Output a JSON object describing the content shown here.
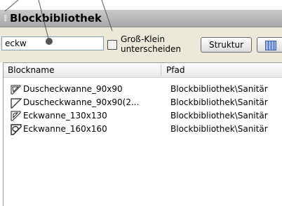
{
  "panel": {
    "title": "Blockbibliothek"
  },
  "search": {
    "value": "eckw"
  },
  "toolbar": {
    "case_label_line1": "Groß-Klein",
    "case_label_line2": "unterscheiden",
    "structure_label": "Struktur"
  },
  "list": {
    "columns": {
      "name": "Blockname",
      "path": "Pfad"
    },
    "rows": [
      {
        "name": "Duscheckwanne_90x90",
        "path": "Blockbibliothek\\Sanitär",
        "icon": "shower-tray-icon"
      },
      {
        "name": "Duscheckwanne_90x90(2...",
        "path": "Blockbibliothek\\Sanitär",
        "icon": "shower-tray-icon"
      },
      {
        "name": "Eckwanne_130x130",
        "path": "Blockbibliothek\\Sanitär",
        "icon": "corner-bathtub-icon"
      },
      {
        "name": "Eckwanne_160x160",
        "path": "Blockbibliothek\\Sanitär",
        "icon": "corner-bathtub-icon"
      }
    ]
  }
}
